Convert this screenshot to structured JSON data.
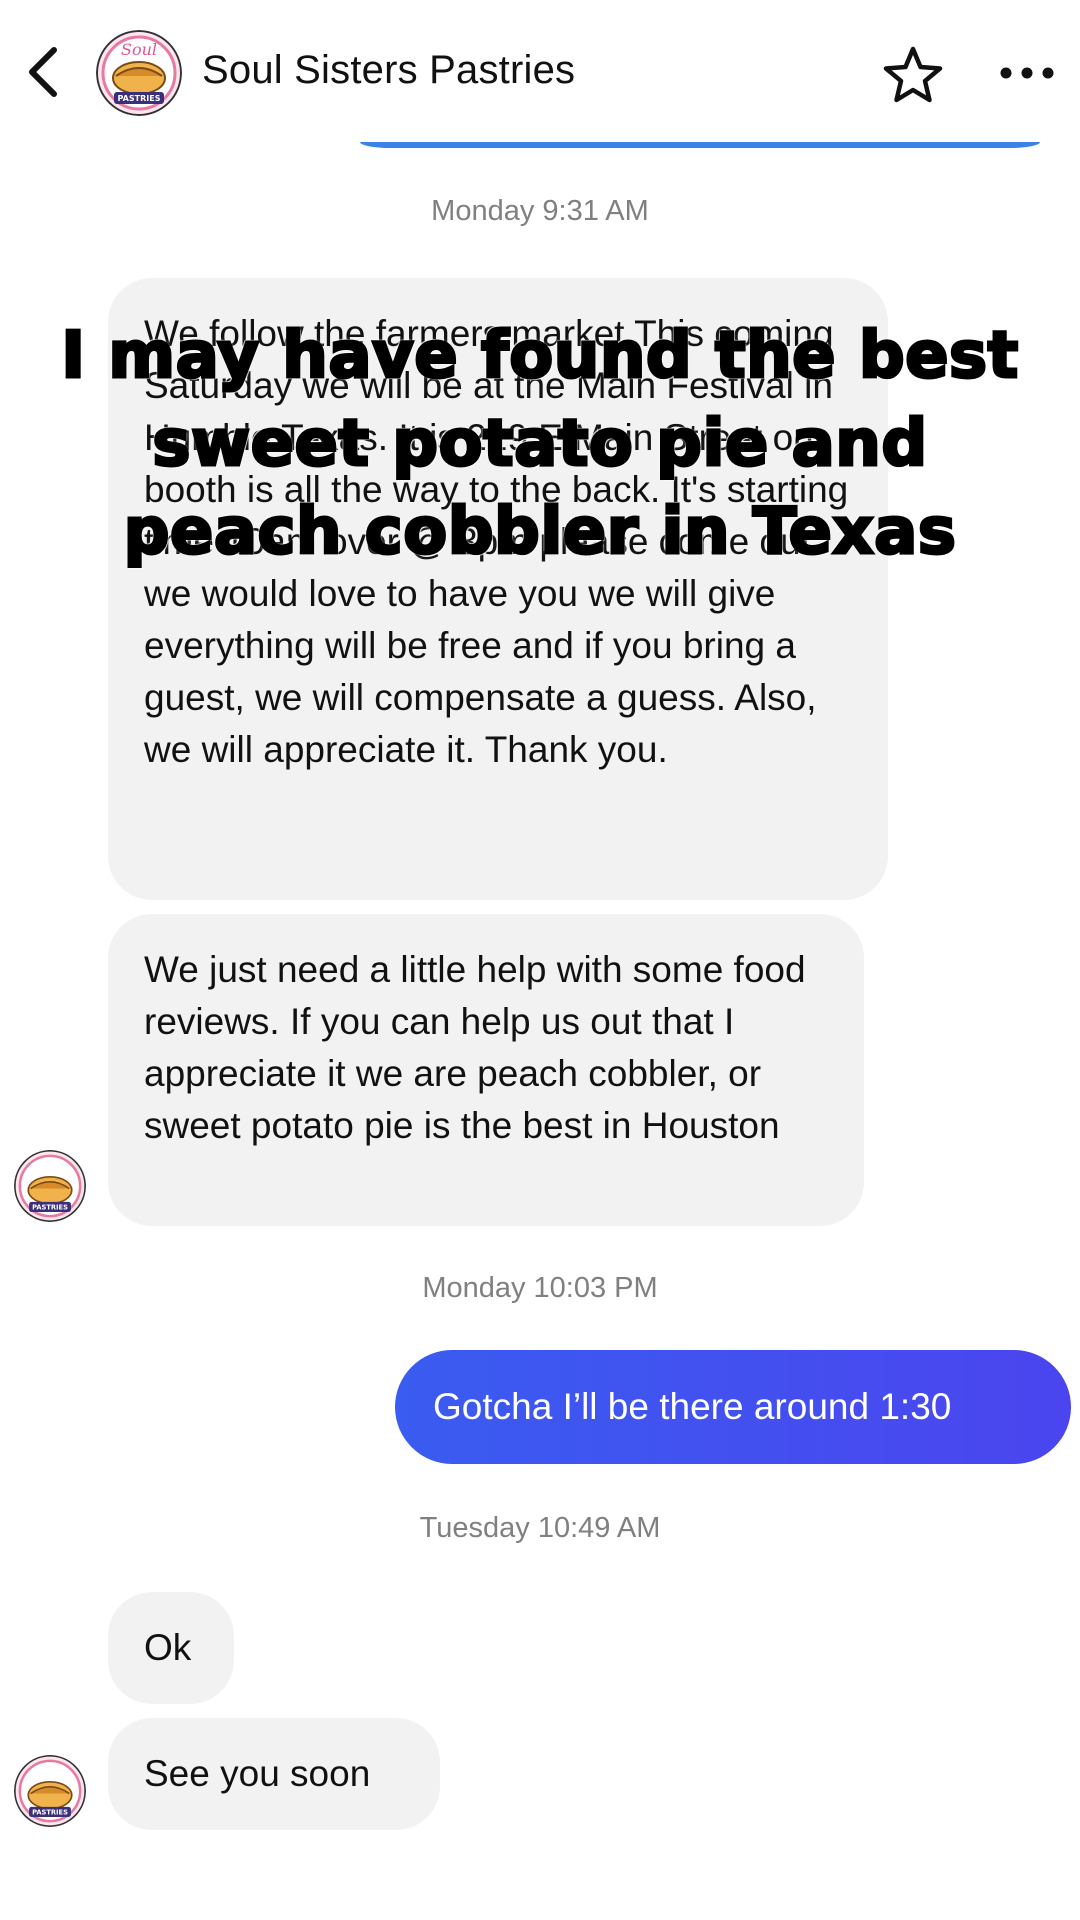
{
  "header": {
    "title": "Soul Sisters Pastries",
    "avatar_label": "Soul Sisters PASTRIES",
    "back_icon": "chevron-left-icon",
    "star_icon": "star-outline-icon",
    "more_icon": "more-horizontal-icon"
  },
  "colors": {
    "accent": "#3b82e6",
    "outgoing_start": "#3a5cf0",
    "outgoing_end": "#4b45ef",
    "incoming_bg": "#f2f2f2",
    "timestamp": "#808080"
  },
  "messages": [
    {
      "type": "timestamp",
      "text": "Monday 9:31 AM"
    },
    {
      "type": "incoming",
      "text": "We follow the farmers market This coming Saturday we will be at the Main Festival in Humble Texas. It is 219 E Main Street our booth is all the way to the back. It's starting time 10am over @ 3pm please come out we would love to have you we will give everything will be free and if you bring a guest, we will compensate a guess. Also, we will appreciate it. Thank you."
    },
    {
      "type": "incoming",
      "text": "We just need a little help with some food reviews. If you can help us out that I appreciate it we are peach cobbler, or sweet potato pie is the best in Houston"
    },
    {
      "type": "timestamp",
      "text": "Monday 10:03 PM"
    },
    {
      "type": "outgoing",
      "text": "Gotcha I’ll be there around 1:30"
    },
    {
      "type": "timestamp",
      "text": "Tuesday 10:49 AM"
    },
    {
      "type": "incoming",
      "text": "Ok"
    },
    {
      "type": "incoming",
      "text": "See you soon"
    }
  ],
  "overlay": {
    "caption": "I may have found the best sweet potato pie and peach cobbler in Texas"
  }
}
